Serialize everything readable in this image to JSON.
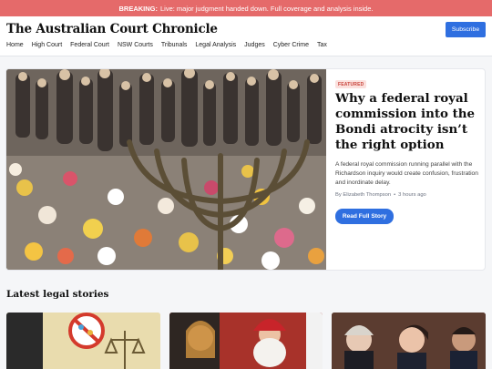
{
  "breaking": {
    "label": "BREAKING:",
    "text": "Live: major judgment handed down. Full coverage and analysis inside."
  },
  "header": {
    "logo": "The Australian Court Chronicle",
    "subscribe": "Subscribe",
    "nav": [
      "Home",
      "High Court",
      "Federal Court",
      "NSW Courts",
      "Tribunals",
      "Legal Analysis",
      "Judges",
      "Cyber Crime",
      "Tax"
    ]
  },
  "hero": {
    "badge": "FEATURED",
    "title": "Why a federal royal commission into the Bondi atrocity isn’t the right option",
    "description": "A federal royal commission running parallel with the Richardson inquiry would create confusion, frustration and inordinate delay.",
    "author": "By Elizabeth Thompson",
    "separator": "•",
    "time": "3 hours ago",
    "button": "Read Full Story"
  },
  "latest": {
    "title": "Latest legal stories"
  }
}
